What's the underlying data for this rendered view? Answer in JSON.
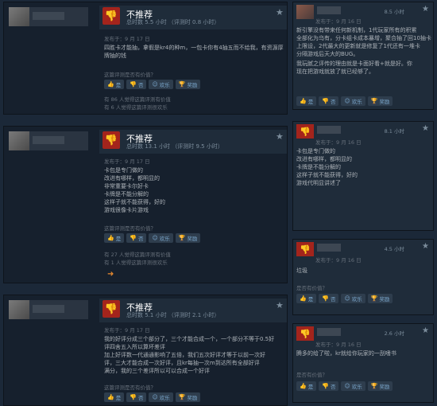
{
  "left": {
    "reviews": [
      {
        "verdict": "不推荐",
        "hours": "总时数 5.5 小时 （评测时 0.8 小时）",
        "date": "发布于：9 月 17 日",
        "text": [
          "四胜卡才能抽，拿假是kr4的种m，一包卡你有4抽五而不给我，有资源厚",
          "牌抽的钱"
        ],
        "question": "这篇评测是否有价值？",
        "buttons": {
          "yes": "是",
          "no": "否",
          "funny": "欢乐",
          "award": "奖励"
        },
        "stats": [
          "有 86 人觉得这篇评测有价值",
          "有 6 人觉得这篇评测很欢乐"
        ]
      },
      {
        "verdict": "不推荐",
        "hours": "总时数 13.1 小时 （评测时 9.5 小时）",
        "date": "发布于：9 月 17 日",
        "text": [
          "卡包是专门做的",
          "改进有哪样，都明显的",
          "非常重要卡尔好卡",
          "卡牌是不能分解的",
          "这样子就不能获得，好的",
          "游戏很像卡片游戏"
        ],
        "question": "这篇评测是否有价值？",
        "buttons": {
          "yes": "是",
          "no": "否",
          "funny": "欢乐",
          "award": "奖励"
        },
        "stats": [
          "有 27 人觉得这篇评测有价值",
          "有 1 人觉得这篇评测很欢乐"
        ],
        "emoji": "➜"
      },
      {
        "verdict": "不推荐",
        "hours": "总时数 5.1 小时 （评测时 2.1 小时）",
        "date": "发布于：9 月 17 日",
        "text": [
          "我的好评分成三个部分了，三个才能合成一个，一个部分不等于0.5好",
          "评四舍五入所以算坏差评",
          "加上好评数一代通通影响了五倍，我们五次好评才等于以前一次好",
          "评，三大才能合成一次好评，且kr每抽一次m到达所有全部好评",
          "满分，我的三个差评所以可以合成一个好评"
        ],
        "question": "这篇评测是否有价值？",
        "buttons": {
          "yes": "是",
          "no": "否",
          "funny": "欢乐",
          "award": "奖励"
        }
      }
    ]
  },
  "right": {
    "cards": [
      {
        "hours": "8.5 小时",
        "date": "发布于：9 月 16 日",
        "text": [
          "新引擎没有带来任何新机制，1代玩家所有的积累",
          "全部化为乌有，分卡组卡成本暴增，聚合抽了回10抽卡",
          "上限设，2代最大的更新就是修复了1代还有一堆卡",
          "分隔游戏后天大的BUG。",
          "我玩腻之评传的理由就是卡面好看+就是好。你",
          "现在把游戏就放了就已经够了。"
        ],
        "buttons": {
          "yes": "是",
          "no": "否",
          "funny": "欢乐",
          "award": "奖励"
        }
      },
      {
        "hours": "8.1 小时",
        "date": "发布于：9 月 16 日",
        "text": [
          "卡包是专门做的",
          "改进有哪样，都明显的",
          "卡牌是不能分解的",
          "这样子就不能获得，好的",
          "游戏代明显讲述了"
        ]
      },
      {
        "hours": "4.5 小时",
        "date": "发布于：9 月 16 日",
        "text": [
          "垃圾"
        ],
        "question": "是否有价值？",
        "buttons": {
          "yes": "是",
          "no": "否",
          "funny": "欢乐",
          "award": "奖励"
        }
      },
      {
        "hours": "2.6 小时",
        "date": "发布于：9 月 16 日",
        "text": [
          "腾多的给了啦，kr就给你玩家的一刮嗜书"
        ],
        "question": "是否有价值？",
        "buttons": {
          "yes": "是",
          "no": "否",
          "funny": "欢乐",
          "award": "奖励"
        }
      }
    ]
  },
  "icons": {
    "thumb_down": "👎",
    "star": "★",
    "yes": "👍",
    "no": "👎",
    "funny": "☺",
    "award": "🏆"
  },
  "colors": {
    "background": "#1b2838",
    "negative": "#a3241c",
    "link": "#7aa7cc"
  }
}
